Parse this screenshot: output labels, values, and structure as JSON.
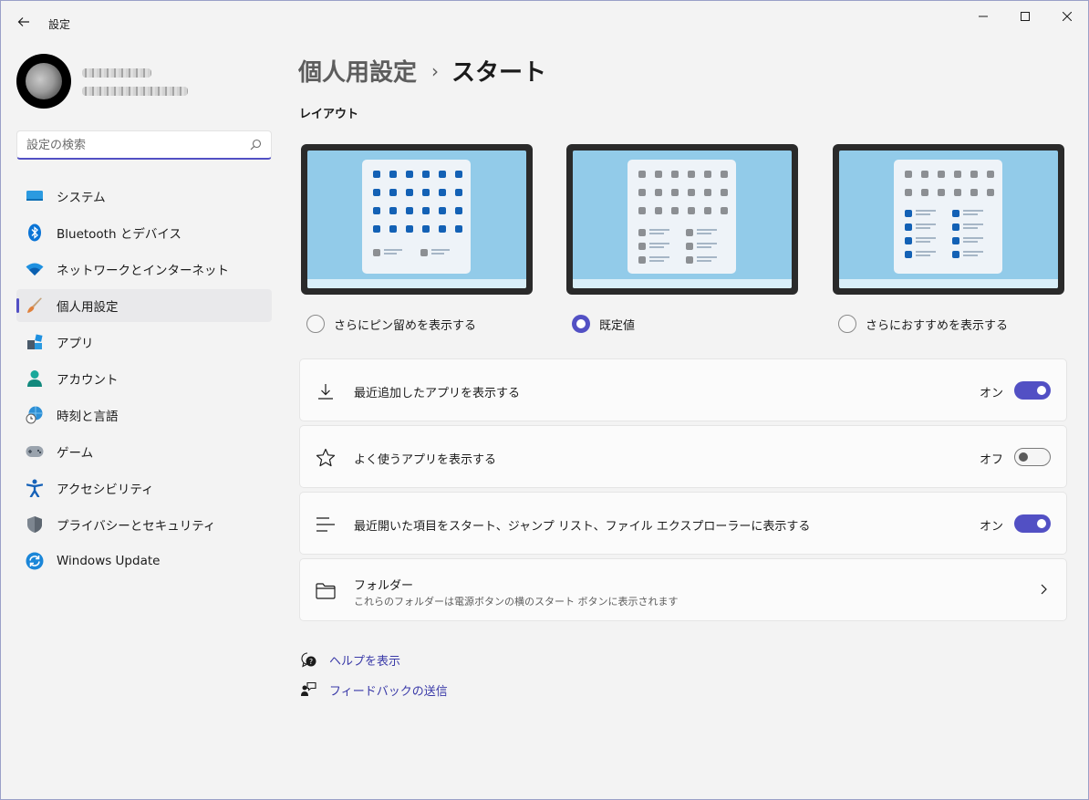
{
  "window": {
    "title": "設定"
  },
  "search": {
    "placeholder": "設定の検索"
  },
  "sidebar": {
    "items": [
      {
        "label": "システム",
        "icon": "monitor-icon"
      },
      {
        "label": "Bluetooth とデバイス",
        "icon": "bluetooth-icon"
      },
      {
        "label": "ネットワークとインターネット",
        "icon": "wifi-icon"
      },
      {
        "label": "個人用設定",
        "icon": "brush-icon",
        "active": true
      },
      {
        "label": "アプリ",
        "icon": "apps-icon"
      },
      {
        "label": "アカウント",
        "icon": "person-icon"
      },
      {
        "label": "時刻と言語",
        "icon": "globe-clock-icon"
      },
      {
        "label": "ゲーム",
        "icon": "gamepad-icon"
      },
      {
        "label": "アクセシビリティ",
        "icon": "accessibility-icon"
      },
      {
        "label": "プライバシーとセキュリティ",
        "icon": "shield-icon"
      },
      {
        "label": "Windows Update",
        "icon": "update-icon"
      }
    ]
  },
  "breadcrumb": {
    "parent": "個人用設定",
    "separator": "›",
    "current": "スタート"
  },
  "layout": {
    "title": "レイアウト",
    "options": [
      {
        "label": "さらにピン留めを表示する",
        "selected": false
      },
      {
        "label": "既定値",
        "selected": true
      },
      {
        "label": "さらにおすすめを表示する",
        "selected": false
      }
    ]
  },
  "settings": [
    {
      "label": "最近追加したアプリを表示する",
      "state": "オン",
      "on": true,
      "icon": "download-icon"
    },
    {
      "label": "よく使うアプリを表示する",
      "state": "オフ",
      "on": false,
      "icon": "star-icon"
    },
    {
      "label": "最近開いた項目をスタート、ジャンプ リスト、ファイル エクスプローラーに表示する",
      "state": "オン",
      "on": true,
      "icon": "list-icon"
    }
  ],
  "folders": {
    "title": "フォルダー",
    "subtitle": "これらのフォルダーは電源ボタンの横のスタート ボタンに表示されます"
  },
  "links": {
    "help": "ヘルプを表示",
    "feedback": "フィードバックの送信"
  },
  "colors": {
    "accent": "#5250c4",
    "link": "#3a3aa8",
    "background": "#f3f3f3"
  }
}
